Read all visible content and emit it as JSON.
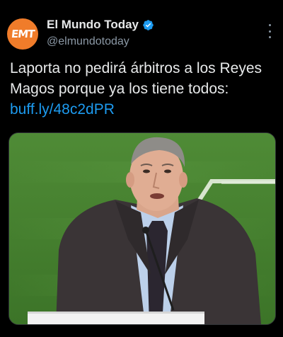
{
  "tweet": {
    "author": {
      "display_name": "El Mundo Today",
      "handle": "@elmundotoday",
      "avatar_text": "EMT",
      "avatar_color": "#f07c2a",
      "verified": true,
      "verified_icon": "verified-badge-icon"
    },
    "text": "Laporta no pedirá árbitros a los Reyes Magos porque ya los tiene todos: ",
    "link_text": "buff.ly/48c2dPR",
    "more_icon": "more-options-icon",
    "colors": {
      "background": "#000000",
      "text": "#e7e9ea",
      "secondary_text": "#8b98a5",
      "link": "#1d9bf0",
      "verified": "#1d9bf0"
    }
  }
}
